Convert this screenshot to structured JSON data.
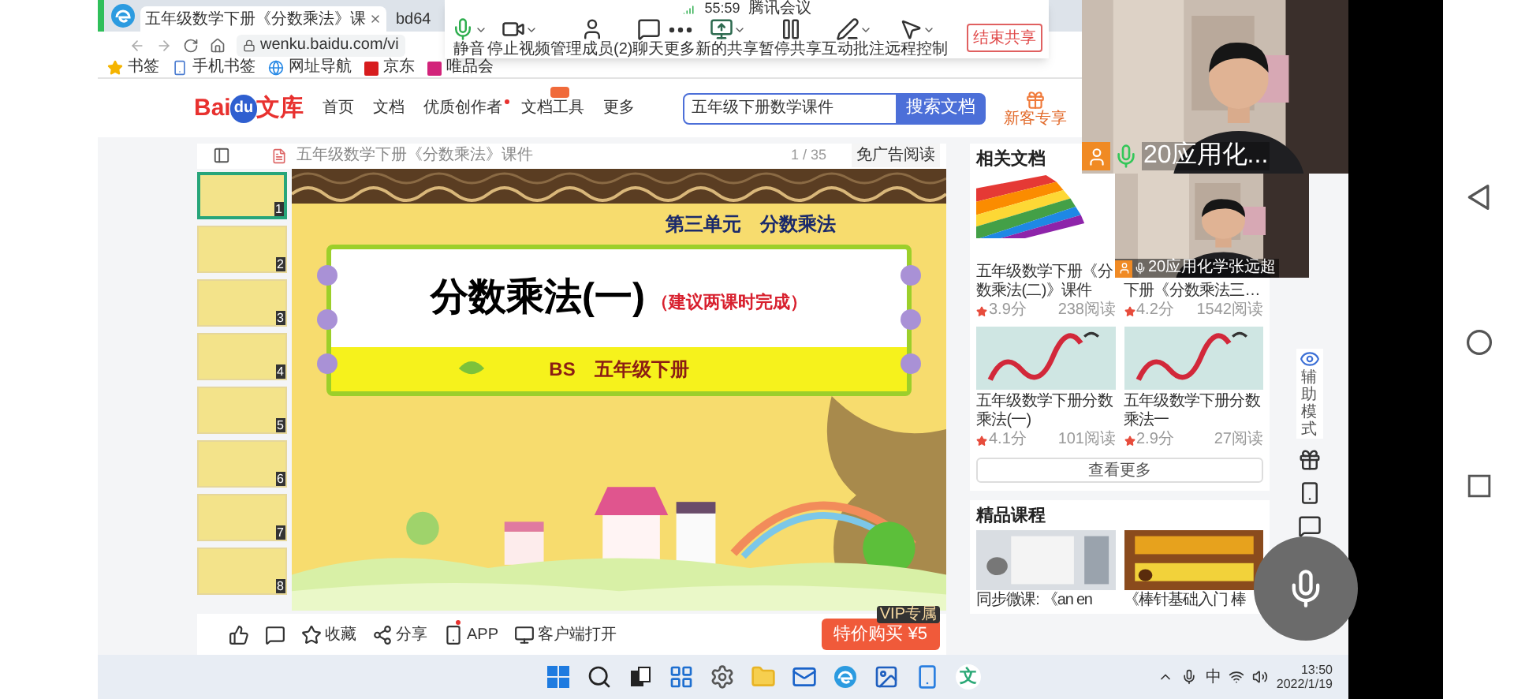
{
  "meeting_toolbar": {
    "timer": "55:59",
    "app_name": "腾讯会议",
    "buttons": [
      {
        "kind": "mic",
        "label": "静音",
        "dropdown": true
      },
      {
        "kind": "video",
        "label": "停止视频",
        "dropdown": true
      },
      {
        "kind": "members",
        "label": "管理成员(2)",
        "dropdown": false
      },
      {
        "kind": "chat",
        "label": "聊天",
        "dropdown": false
      },
      {
        "kind": "more",
        "label": "更多",
        "dropdown": false
      },
      {
        "kind": "share",
        "label": "新的共享",
        "dropdown": true
      },
      {
        "kind": "pause",
        "label": "暂停共享",
        "dropdown": false
      },
      {
        "kind": "annotate",
        "label": "互动批注",
        "dropdown": true
      },
      {
        "kind": "remote",
        "label": "远程控制",
        "dropdown": true
      }
    ],
    "end_button": "结束共享"
  },
  "browser": {
    "tabs": [
      {
        "title": "五年级数学下册《分数乘法》课",
        "selected": true
      },
      {
        "title": "bd64",
        "selected": false
      }
    ],
    "address": "wenku.baidu.com/vi",
    "bookmarks": [
      {
        "kind": "star",
        "label": "书签"
      },
      {
        "kind": "phone",
        "label": "手机书签"
      },
      {
        "kind": "globe",
        "label": "网址导航"
      },
      {
        "kind": "jd",
        "label": "京东"
      },
      {
        "kind": "vip",
        "label": "唯品会"
      }
    ]
  },
  "site_header": {
    "logo": [
      "Bai",
      "du",
      "文库"
    ],
    "nav": [
      {
        "label": "首页",
        "dot": false,
        "new_badge": false
      },
      {
        "label": "文档",
        "dot": false,
        "new_badge": false
      },
      {
        "label": "优质创作者",
        "dot": true,
        "new_badge": false
      },
      {
        "label": "文档工具",
        "dot": false,
        "new_badge": true
      },
      {
        "label": "更多",
        "dot": false,
        "new_badge": false
      }
    ],
    "search_value": "五年级下册数学课件",
    "search_button": "搜索文档",
    "promo": "新客专享"
  },
  "doc": {
    "title": "五年级数学下册《分数乘法》课件",
    "page": "1 / 35",
    "ad_free": "免广告阅读",
    "thumbnails": [
      {
        "number": "1",
        "selected": true
      },
      {
        "number": "2",
        "selected": false
      },
      {
        "number": "3",
        "selected": false
      },
      {
        "number": "4",
        "selected": false
      },
      {
        "number": "5",
        "selected": false
      },
      {
        "number": "6",
        "selected": false
      },
      {
        "number": "7",
        "selected": false
      },
      {
        "number": "8",
        "selected": false
      }
    ],
    "slide": {
      "unit": "第三单元　分数乘法",
      "title": "分数乘法(一)",
      "note": "（建议两课时完成）",
      "edition": "BS　五年级下册"
    },
    "actions": [
      {
        "kind": "like"
      },
      {
        "kind": "comment"
      },
      {
        "kind": "star",
        "label": "收藏"
      },
      {
        "kind": "share",
        "label": "分享"
      },
      {
        "kind": "phone",
        "label": "APP",
        "dot": true
      },
      {
        "kind": "monitor",
        "label": "客户端打开"
      }
    ],
    "buy_button": "特价购买 ¥5",
    "vip_badge": "VIP专属"
  },
  "related": {
    "heading": "相关文档",
    "items": [
      {
        "kind": "picture",
        "title": "五年级数学下册《分数乘法(二)》课件",
        "rating": "3.9分",
        "reads": "238阅读"
      },
      {
        "kind": "covered",
        "title": "下册《分数乘法三…",
        "rating": "4.2分",
        "reads": "1542阅读"
      },
      {
        "kind": "picture",
        "title": "五年级数学下册分数乘法(一)",
        "rating": "4.1分",
        "reads": "101阅读"
      },
      {
        "kind": "picture",
        "title": "五年级数学下册分数乘法一",
        "rating": "2.9分",
        "reads": "27阅读"
      }
    ],
    "more": "查看更多"
  },
  "courses": {
    "heading": "精品课程",
    "items": [
      {
        "title": "同步微课: 《an en"
      },
      {
        "title": "《棒针基础入门 棒"
      }
    ]
  },
  "side_tools": [
    {
      "kind": "assist",
      "label": "辅助模式"
    },
    {
      "kind": "gift"
    },
    {
      "kind": "phone"
    },
    {
      "kind": "comment"
    }
  ],
  "video_tiles": [
    {
      "name": "20应用化..."
    },
    {
      "name": "20应用化学张远超"
    }
  ],
  "taskbar": {
    "apps": [
      {
        "kind": "windows"
      },
      {
        "kind": "search"
      },
      {
        "kind": "taskview"
      },
      {
        "kind": "widgets"
      },
      {
        "kind": "settings"
      },
      {
        "kind": "folder"
      },
      {
        "kind": "mail"
      },
      {
        "kind": "edge"
      },
      {
        "kind": "photos"
      },
      {
        "kind": "phone"
      },
      {
        "kind": "wenku",
        "label": "文"
      }
    ],
    "ime": "中",
    "time": "13:50",
    "date": "2022/1/19"
  }
}
